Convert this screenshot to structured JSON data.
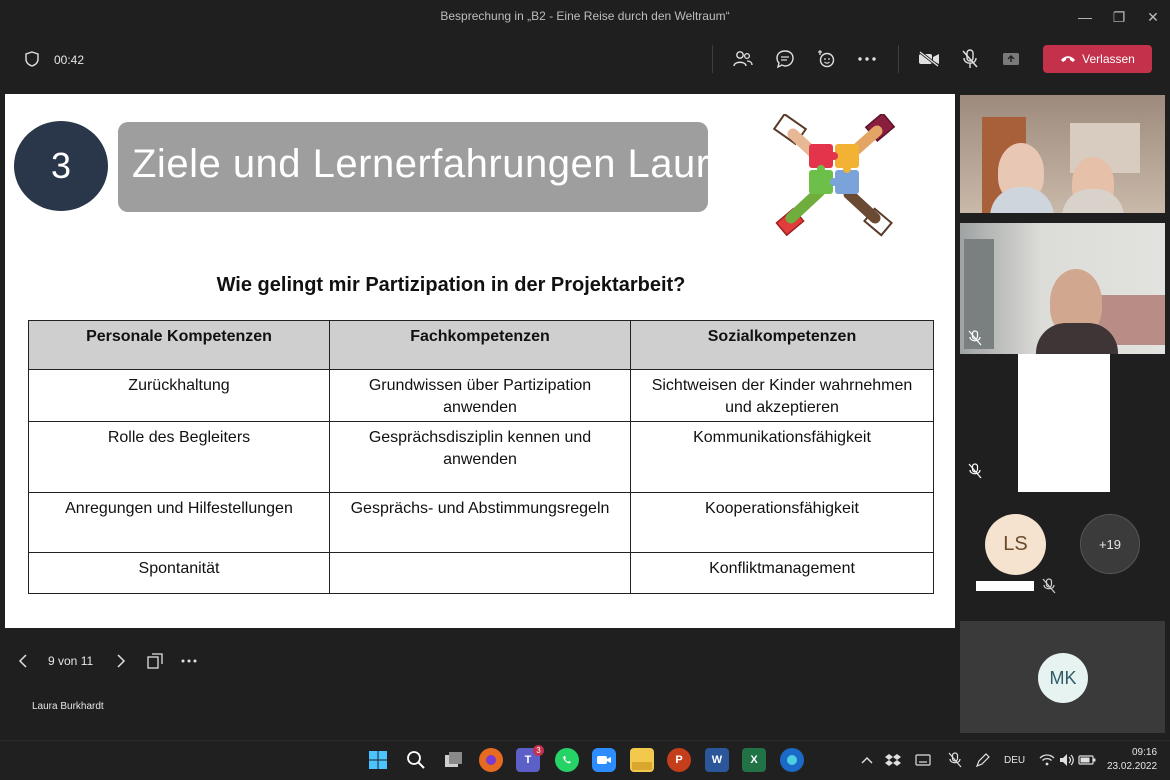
{
  "window": {
    "title": "Besprechung in „B2 - Eine Reise durch den Weltraum“"
  },
  "toolbar": {
    "timer": "00:42",
    "leave_label": "Verlassen"
  },
  "slide": {
    "number": "3",
    "banner_title": "Ziele und Lernerfahrungen Laura",
    "question": "Wie gelingt mir Partizipation in der Projektarbeit?",
    "table": {
      "headers": [
        "Personale Kompetenzen",
        "Fachkompetenzen",
        "Sozialkompetenzen"
      ],
      "rows": [
        [
          "Zurückhaltung",
          "Grundwissen über Partizipation anwenden",
          "Sichtweisen der Kinder wahrnehmen und akzeptieren"
        ],
        [
          "Rolle des Begleiters",
          "Gesprächsdisziplin kennen und anwenden",
          "Kommunikationsfähigkeit"
        ],
        [
          "Anregungen und Hilfestellungen",
          "Gesprächs- und Abstimmungsregeln",
          "Kooperationsfähigkeit"
        ],
        [
          "Spontanität",
          "",
          "Konfliktmanagement"
        ]
      ]
    }
  },
  "slide_nav": {
    "page": "9 von 11"
  },
  "presenter": "Laura Burkhardt",
  "participants": {
    "ls_initials": "LS",
    "more_count": "+19",
    "mk_initials": "MK"
  },
  "taskbar": {
    "teams_badge": "3",
    "language": "DEU",
    "time": "09:16",
    "date": "23.02.2022"
  },
  "colors": {
    "leave": "#c4314b",
    "slide_badge": "#2a3649",
    "banner": "#9e9e9e",
    "table_header": "#cfcfcf"
  }
}
